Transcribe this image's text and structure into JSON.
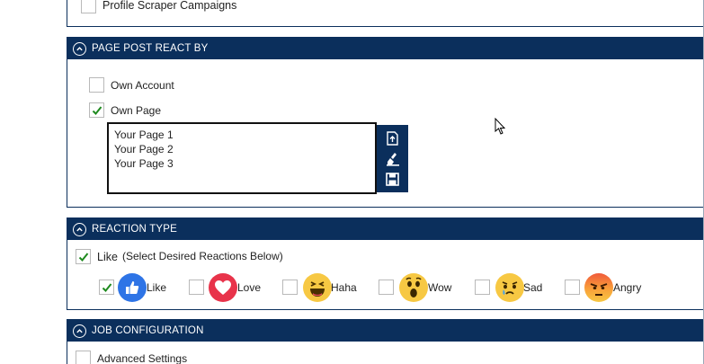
{
  "top": {
    "label": "Profile Scraper Campaigns"
  },
  "page_post_react_by": {
    "title": "PAGE POST REACT BY",
    "own_account": {
      "label": "Own Account",
      "checked": false
    },
    "own_page": {
      "label": "Own Page",
      "checked": true
    },
    "pages": [
      "Your Page 1",
      "Your Page 2",
      "Your Page 3"
    ],
    "tools": [
      "import-icon",
      "clear-icon",
      "save-icon"
    ]
  },
  "reaction_type": {
    "title": "REACTION TYPE",
    "like_main": {
      "label": "Like",
      "hint": "(Select Desired Reactions Below)",
      "checked": true
    },
    "reactions": [
      {
        "label": "Like",
        "checked": true
      },
      {
        "label": "Love",
        "checked": false
      },
      {
        "label": "Haha",
        "checked": false
      },
      {
        "label": "Wow",
        "checked": false
      },
      {
        "label": "Sad",
        "checked": false
      },
      {
        "label": "Angry",
        "checked": false
      }
    ]
  },
  "job_configuration": {
    "title": "JOB CONFIGURATION",
    "advanced": {
      "label": "Advanced Settings",
      "checked": false
    }
  },
  "colors": {
    "header": "#0b2f5c",
    "check": "#1e8a1e",
    "like": "#2e74e6",
    "love": "#e8334a",
    "emoji": "#f7c843",
    "angry": "#f06a3a"
  }
}
